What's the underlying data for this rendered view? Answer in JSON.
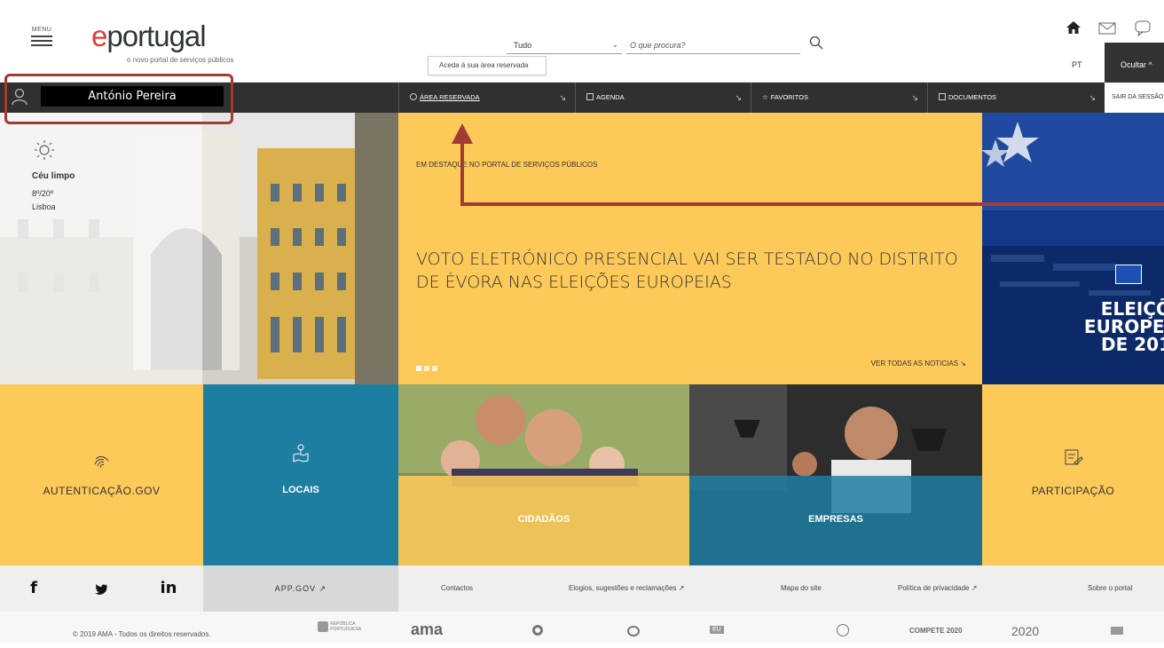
{
  "header": {
    "menu_label": "MENU",
    "logo_brand_prefix": "e",
    "logo_brand_rest": "portugal",
    "logo_tagline": "o novo portal de serviços públicos",
    "search_scope": "Tudo",
    "search_placeholder": "O que procura?",
    "tooltip": "Aceda à sua área reservada",
    "language": "PT",
    "hide_label": "Ocultar ^"
  },
  "userbar": {
    "user_name": "António Pereira",
    "nav": [
      {
        "label": "Área reservada",
        "icon": "gear-icon"
      },
      {
        "label": "Agenda",
        "icon": "calendar-icon"
      },
      {
        "label": "Favoritos",
        "icon": "star-icon"
      },
      {
        "label": "Documentos",
        "icon": "document-icon"
      }
    ],
    "logout_label": "SAIR DA SESSÃO"
  },
  "weather": {
    "condition": "Céu limpo",
    "temperature": "8º/20º",
    "city": "Lisboa"
  },
  "feature": {
    "kicker": "Em destaque no portal de serviços públicos",
    "headline": "VOTO ELETRÓNICO PRESENCIAL VAI SER TESTADO NO DISTRITO DE ÉVORA NAS ELEIÇÕES EUROPEIAS",
    "more_label": "Ver todas as noticias ↘"
  },
  "euro_panel": {
    "lines": [
      "ELEIÇÕ",
      "EUROPEI",
      "DE 201"
    ]
  },
  "tiles": [
    {
      "label": "Autenticação.gov",
      "icon": "fingerprint-icon"
    },
    {
      "label": "Locais",
      "icon": "map-pin-icon"
    },
    {
      "label": "Cidadãos",
      "icon": ""
    },
    {
      "label": "Empresas",
      "icon": ""
    },
    {
      "label": "Participação",
      "icon": "participation-icon"
    }
  ],
  "footer": {
    "social": [
      "f",
      "🐦",
      "in"
    ],
    "appgov": "APP.GOV ↗",
    "links": [
      "Contactos",
      "Elogios, sugestões e reclamações ↗",
      "Mapa do site",
      "Política de privacidade ↗",
      "Sobre o portal"
    ],
    "copyright": "© 2019 AMA - Todos os direitos reservados.",
    "partners": [
      "REPÚBLICA PORTUGUESA",
      "ama",
      "",
      "",
      "EU",
      "",
      "COMPETE 2020",
      "2020",
      ""
    ]
  },
  "colors": {
    "accent_yellow": "#fdc959",
    "accent_blue": "#1e7ea1",
    "dark_bar": "#303030",
    "annotation_red": "#a33b32"
  }
}
